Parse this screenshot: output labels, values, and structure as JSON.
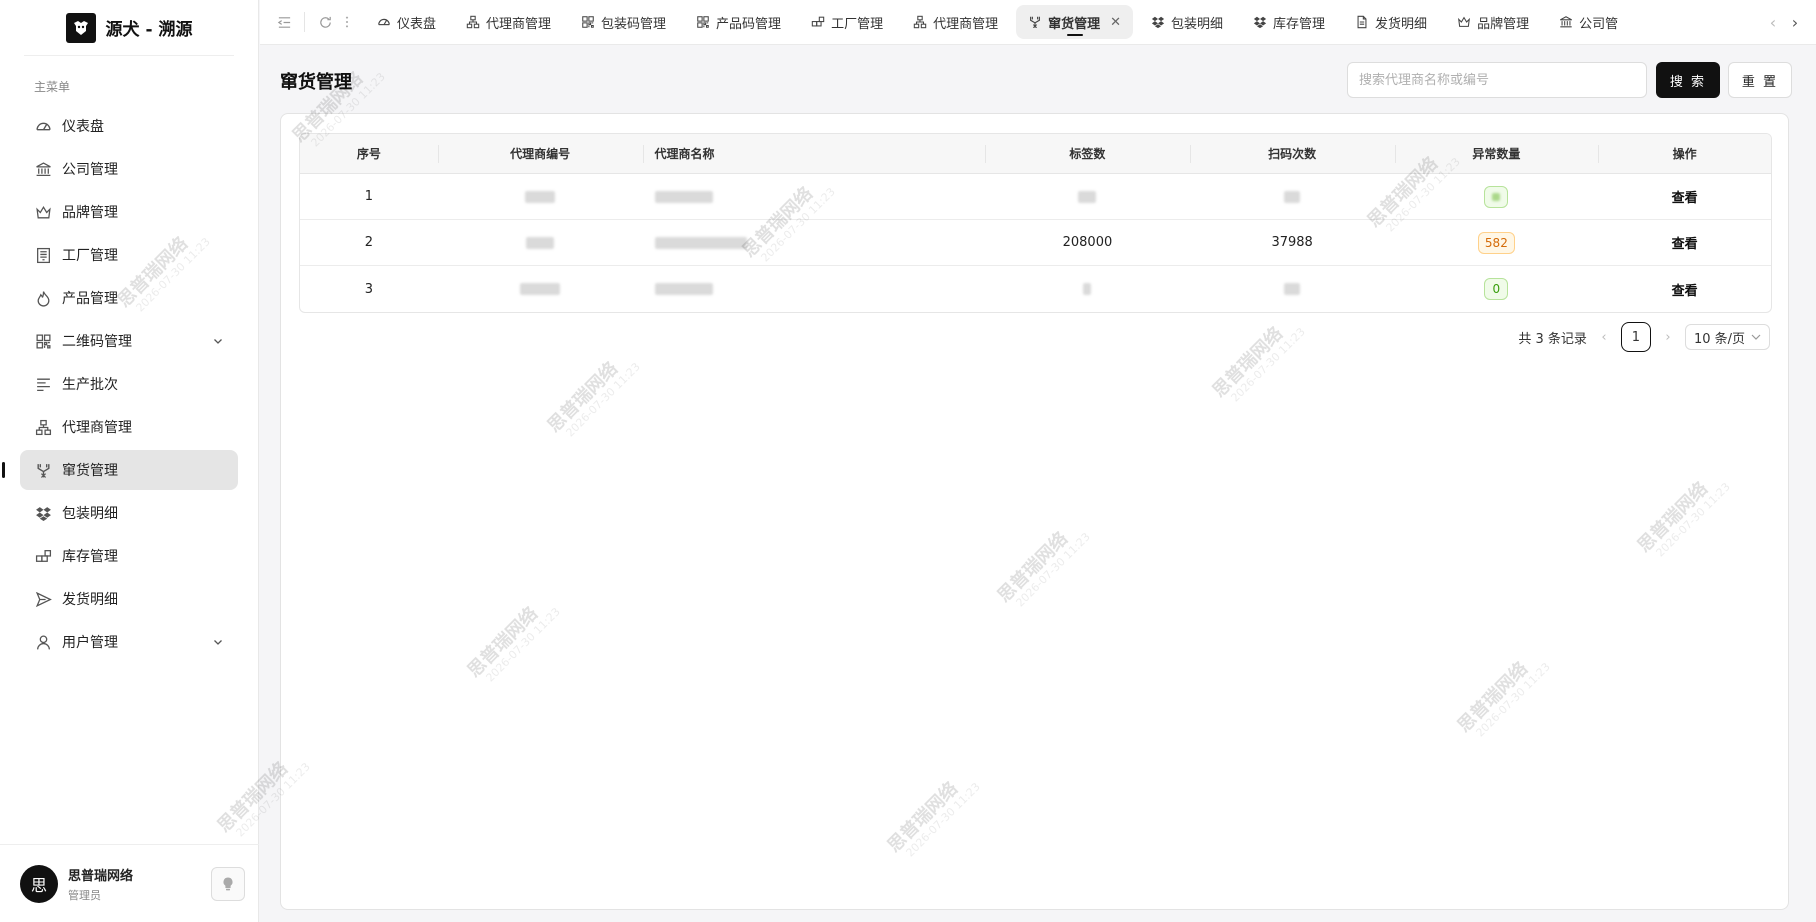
{
  "brand": {
    "title": "源犬 - 溯源",
    "logo_icon": "dog-logo-icon"
  },
  "sidebar": {
    "group_label": "主菜单",
    "items": [
      {
        "label": "仪表盘",
        "icon": "dashboard-icon"
      },
      {
        "label": "公司管理",
        "icon": "bank-icon"
      },
      {
        "label": "品牌管理",
        "icon": "crown-icon"
      },
      {
        "label": "工厂管理",
        "icon": "building-icon"
      },
      {
        "label": "产品管理",
        "icon": "flame-icon"
      },
      {
        "label": "二维码管理",
        "icon": "qrcode-icon",
        "expandable": true
      },
      {
        "label": "生产批次",
        "icon": "bars-icon"
      },
      {
        "label": "代理商管理",
        "icon": "cluster-icon"
      },
      {
        "label": "窜货管理",
        "icon": "fork-icon",
        "active": true
      },
      {
        "label": "包装明细",
        "icon": "dropbox-icon"
      },
      {
        "label": "库存管理",
        "icon": "boxes-icon"
      },
      {
        "label": "发货明细",
        "icon": "send-icon"
      },
      {
        "label": "用户管理",
        "icon": "user-icon",
        "expandable": true
      }
    ]
  },
  "user": {
    "name": "思普瑞网络",
    "role": "管理员",
    "avatar_text": "思"
  },
  "tabs": [
    {
      "label": "仪表盘",
      "icon": "dashboard-icon"
    },
    {
      "label": "代理商管理",
      "icon": "cluster-icon"
    },
    {
      "label": "包装码管理",
      "icon": "qrcode-icon"
    },
    {
      "label": "产品码管理",
      "icon": "qrcode-icon"
    },
    {
      "label": "工厂管理",
      "icon": "boxes-icon"
    },
    {
      "label": "代理商管理",
      "icon": "cluster-icon"
    },
    {
      "label": "窜货管理",
      "icon": "fork-icon",
      "active": true,
      "closable": true
    },
    {
      "label": "包装明细",
      "icon": "dropbox-icon"
    },
    {
      "label": "库存管理",
      "icon": "dropbox-icon"
    },
    {
      "label": "发货明细",
      "icon": "file-icon"
    },
    {
      "label": "品牌管理",
      "icon": "crown-icon"
    },
    {
      "label": "公司管",
      "icon": "bank-icon"
    }
  ],
  "page": {
    "title": "窜货管理",
    "search_placeholder": "搜索代理商名称或编号",
    "search_value": "",
    "search_button": "搜 索",
    "reset_button": "重 置"
  },
  "table": {
    "columns": [
      "序号",
      "代理商编号",
      "代理商名称",
      "标签数",
      "扫码次数",
      "异常数量",
      "操作"
    ],
    "rows": [
      {
        "index": "1",
        "code": "",
        "name": "",
        "labels": "",
        "scans": "",
        "abnormal": "",
        "abnormal_color": "green",
        "action": "查看"
      },
      {
        "index": "2",
        "code": "",
        "name": "",
        "labels": "208000",
        "scans": "37988",
        "abnormal": "582",
        "abnormal_color": "orange",
        "action": "查看"
      },
      {
        "index": "3",
        "code": "",
        "name": "",
        "labels": "",
        "scans": "",
        "abnormal": "0",
        "abnormal_color": "green",
        "action": "查看"
      }
    ]
  },
  "pagination": {
    "total_text": "共 3 条记录",
    "current_page": "1",
    "page_size": "10 条/页"
  },
  "watermark": {
    "text": "思普瑞网络",
    "time": "2026-07-30 11:23"
  },
  "colors": {
    "accent": "#111111",
    "active_bg": "#e5e5e5",
    "badge_green": "#389e0d",
    "badge_orange": "#d46b08"
  }
}
